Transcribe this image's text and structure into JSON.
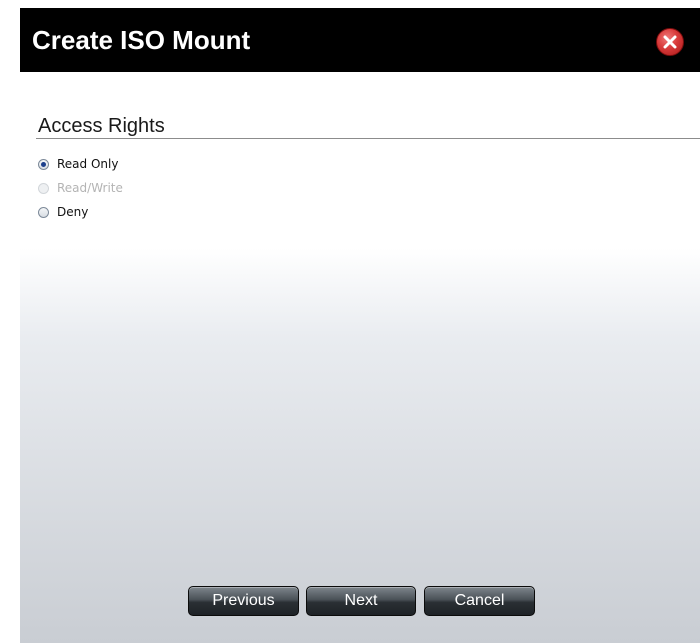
{
  "dialog": {
    "title": "Create ISO Mount",
    "close_icon": "close-icon"
  },
  "access_rights": {
    "heading": "Access Rights",
    "options": [
      {
        "label": "Read Only",
        "selected": true,
        "disabled": false
      },
      {
        "label": "Read/Write",
        "selected": false,
        "disabled": true
      },
      {
        "label": "Deny",
        "selected": false,
        "disabled": false
      }
    ]
  },
  "footer": {
    "previous_label": "Previous",
    "next_label": "Next",
    "cancel_label": "Cancel"
  },
  "colors": {
    "titlebar": "#000000",
    "close_button": "#d83a3a",
    "button": "#2a2f34",
    "radio_selected": "#1c3f8c"
  }
}
